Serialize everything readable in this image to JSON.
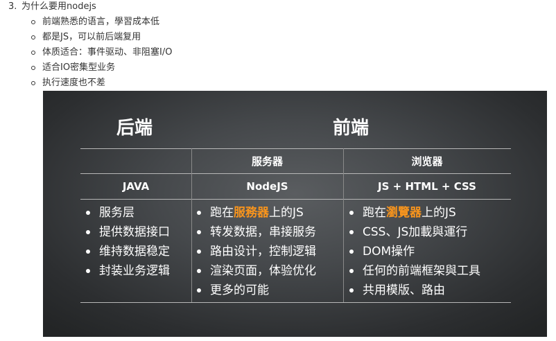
{
  "intro": {
    "number": "3.",
    "heading": "为什么要用nodejs",
    "points": [
      "前端熟悉的语言，學習成本低",
      "都是JS，可以前后端复用",
      "体质适合：事件驱动、非阻塞I/O",
      "适合IO密集型业务",
      "执行速度也不差"
    ]
  },
  "slide": {
    "background_color": "#3a3d40",
    "accent_color": "#f7941d",
    "headers": {
      "backend": "后端",
      "frontend": "前端"
    },
    "server_label": "服务器",
    "browser_label": "浏览器",
    "tech": {
      "java": "JAVA",
      "nodejs": "NodeJS",
      "web": "JS + HTML + CSS"
    },
    "java_points": [
      "服务层",
      "提供数据接口",
      "维持数据稳定",
      "封装业务逻辑"
    ],
    "node_points": {
      "first": {
        "before": "跑在",
        "highlight": "服務器",
        "after": "上的JS"
      },
      "rest": [
        "转发数据，串接服务",
        "路由设计，控制逻辑",
        "渲染页面，体验优化",
        "更多的可能"
      ]
    },
    "web_points": {
      "first": {
        "before": "跑在",
        "highlight": "瀏覽器",
        "after": "上的JS"
      },
      "rest": [
        "CSS、JS加載與運行",
        "DOM操作",
        "任何的前端框架與工具",
        "共用模版、路由"
      ]
    }
  }
}
